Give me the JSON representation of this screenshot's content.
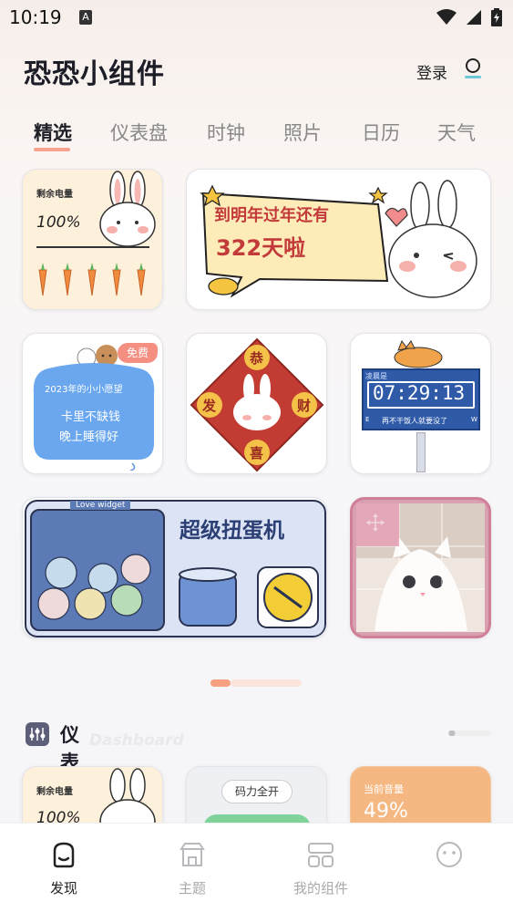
{
  "status_bar": {
    "time": "10:19",
    "notification_badge": "A",
    "icons": [
      "wifi-icon",
      "signal-icon",
      "battery-icon"
    ]
  },
  "header": {
    "app_title": "恐恐小组件",
    "login_label": "登录",
    "profile_icon": "user-icon"
  },
  "tabs": [
    {
      "label": "精选",
      "active": true
    },
    {
      "label": "仪表盘",
      "active": false
    },
    {
      "label": "时钟",
      "active": false
    },
    {
      "label": "照片",
      "active": false
    },
    {
      "label": "日历",
      "active": false
    },
    {
      "label": "天气",
      "active": false
    }
  ],
  "widgets": {
    "carrot": {
      "title": "剩余电量",
      "percent": "100%"
    },
    "countdown": {
      "line1": "到明年过年还有",
      "line2": "322天啦"
    },
    "wish": {
      "badge": "免费",
      "title": "2023年的小小愿望",
      "line1": "卡里不缺钱",
      "line2": "晚上睡得好"
    },
    "blessing": {
      "top": "恭",
      "left": "发",
      "right": "财",
      "bottom": "喜"
    },
    "clock": {
      "label": "凌晨是",
      "time": "07:29:13",
      "bottom_text": "再不干饭人就要没了",
      "e": "E",
      "w": "W"
    },
    "gacha": {
      "label": "Love widget",
      "title": "超级扭蛋机"
    },
    "photo": {
      "move_icon": "move-icon"
    }
  },
  "section": {
    "title": "仪表盘",
    "watermark": "Dashboard"
  },
  "preview_cards": {
    "carrot": {
      "title": "剩余电量",
      "percent": "100%"
    },
    "pill": {
      "label": "码力全开"
    },
    "volume": {
      "label": "当前音量",
      "value": "49%"
    }
  },
  "bottom_nav": [
    {
      "label": "发现",
      "icon": "discover-icon",
      "active": true
    },
    {
      "label": "主题",
      "icon": "store-icon",
      "active": false
    },
    {
      "label": "我的组件",
      "icon": "widgets-icon",
      "active": false
    },
    {
      "label": "",
      "icon": "smiley-icon",
      "active": false
    }
  ],
  "colors": {
    "accent": "#f5a080",
    "tab_active": "#1f1f28",
    "tab_inactive": "#888888"
  }
}
